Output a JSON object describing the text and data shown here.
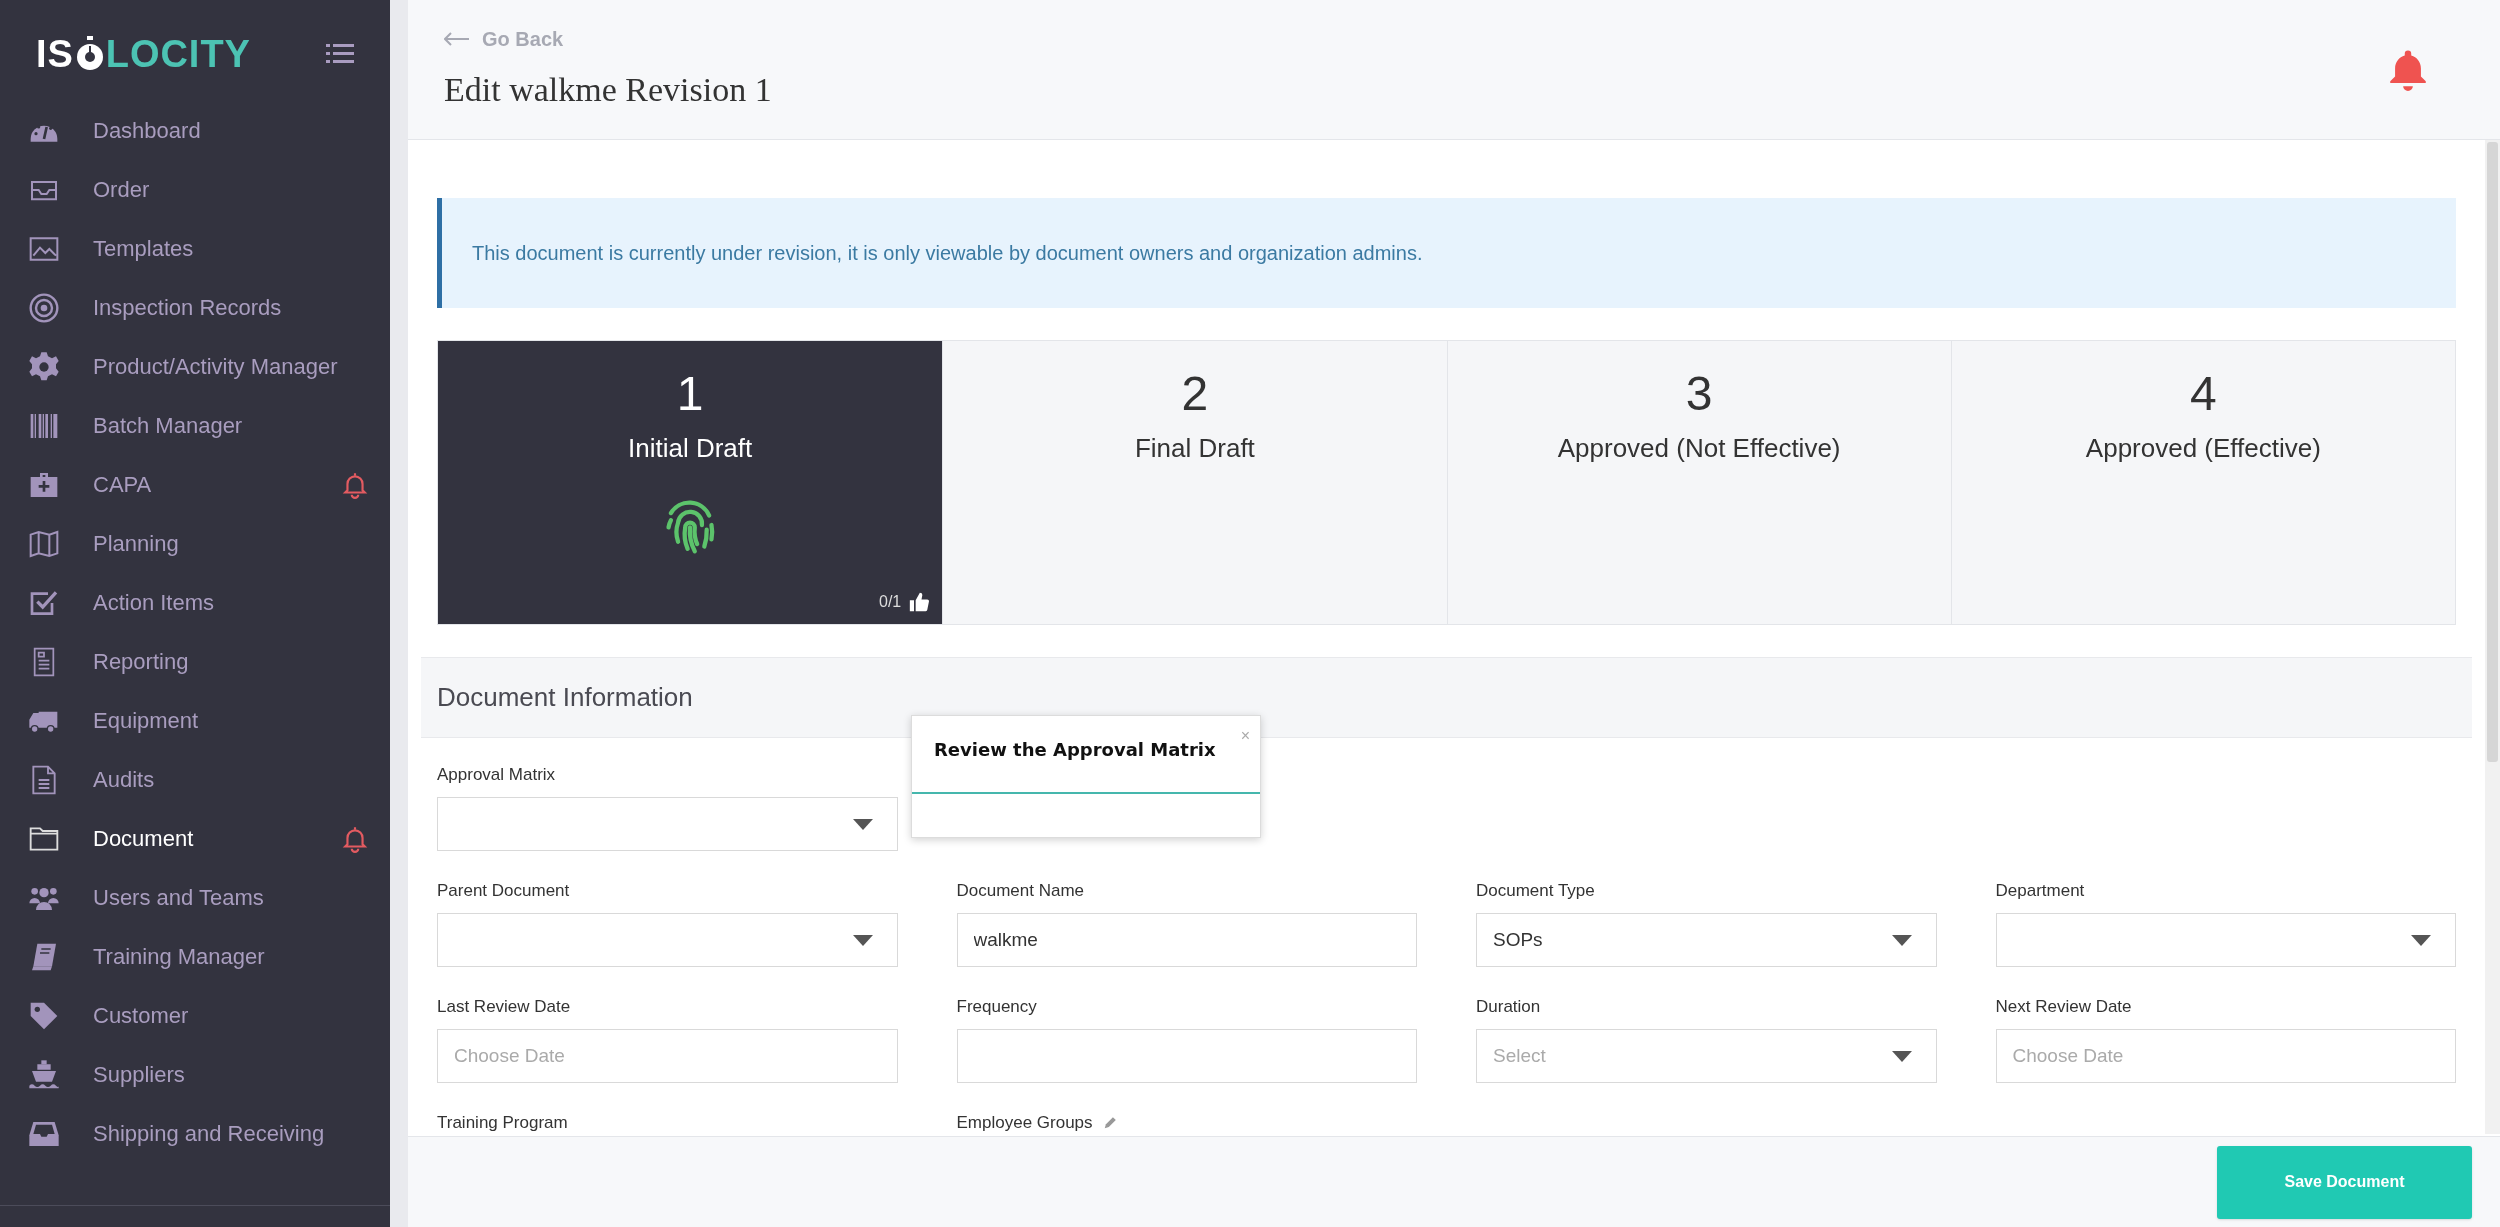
{
  "sidebar": {
    "logo": {
      "prefix": "IS",
      "suffix": "LOCITY"
    },
    "items": [
      {
        "label": "Dashboard",
        "selected": false,
        "alert": false
      },
      {
        "label": "Order",
        "selected": false,
        "alert": false
      },
      {
        "label": "Templates",
        "selected": false,
        "alert": false
      },
      {
        "label": "Inspection Records",
        "selected": false,
        "alert": false
      },
      {
        "label": "Product/Activity Manager",
        "selected": false,
        "alert": false
      },
      {
        "label": "Batch Manager",
        "selected": false,
        "alert": false
      },
      {
        "label": "CAPA",
        "selected": false,
        "alert": true
      },
      {
        "label": "Planning",
        "selected": false,
        "alert": false
      },
      {
        "label": "Action Items",
        "selected": false,
        "alert": false
      },
      {
        "label": "Reporting",
        "selected": false,
        "alert": false
      },
      {
        "label": "Equipment",
        "selected": false,
        "alert": false
      },
      {
        "label": "Audits",
        "selected": false,
        "alert": false
      },
      {
        "label": "Document",
        "selected": true,
        "alert": true
      },
      {
        "label": "Users and Teams",
        "selected": false,
        "alert": false
      },
      {
        "label": "Training Manager",
        "selected": false,
        "alert": false
      },
      {
        "label": "Customer",
        "selected": false,
        "alert": false
      },
      {
        "label": "Suppliers",
        "selected": false,
        "alert": false
      },
      {
        "label": "Shipping and Receiving",
        "selected": false,
        "alert": false
      }
    ]
  },
  "header": {
    "back": "Go Back",
    "title": "Edit walkme Revision 1"
  },
  "notice": "This document is currently under revision, it is only viewable by document owners and organization admins.",
  "steps": [
    {
      "number": "1",
      "label": "Initial Draft",
      "selected": true,
      "approvals": "0/1"
    },
    {
      "number": "2",
      "label": "Final Draft",
      "selected": false
    },
    {
      "number": "3",
      "label": "Approved (Not Effective)",
      "selected": false
    },
    {
      "number": "4",
      "label": "Approved (Effective)",
      "selected": false
    }
  ],
  "section": {
    "title": "Document Information"
  },
  "tooltip": {
    "title": "Review the Approval Matrix",
    "close": "×"
  },
  "form_rows": [
    [
      {
        "kind": "select",
        "label": "Approval Matrix"
      }
    ],
    [
      {
        "kind": "select",
        "label": "Parent Document"
      },
      {
        "kind": "input",
        "label": "Document Name",
        "value": "walkme"
      },
      {
        "kind": "select",
        "label": "Document Type",
        "value": "SOPs"
      },
      {
        "kind": "select",
        "label": "Department"
      }
    ],
    [
      {
        "kind": "input",
        "label": "Last Review Date",
        "placeholder": "Choose Date"
      },
      {
        "kind": "input",
        "label": "Frequency"
      },
      {
        "kind": "select",
        "label": "Duration",
        "placeholder": "Select"
      },
      {
        "kind": "input",
        "label": "Next Review Date",
        "placeholder": "Choose Date"
      }
    ],
    [
      {
        "kind": "label",
        "label": "Training Program"
      },
      {
        "kind": "label",
        "label": "Employee Groups",
        "editable": true
      }
    ]
  ],
  "footer": {
    "save": "Save Document"
  }
}
